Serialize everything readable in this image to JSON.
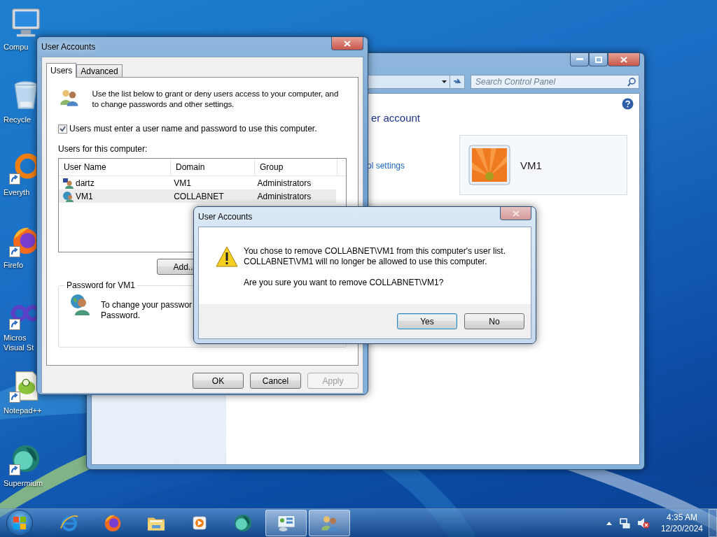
{
  "desktop_icons": [
    {
      "kind": "computer",
      "lines": [
        "Compu"
      ],
      "shortcut": false
    },
    {
      "kind": "recycle-bin",
      "lines": [
        "Recycle"
      ],
      "shortcut": false
    },
    {
      "kind": "ring",
      "lines": [
        "Everyth"
      ],
      "shortcut": true
    },
    {
      "kind": "fox",
      "lines": [
        "Firefo"
      ],
      "shortcut": true
    },
    {
      "kind": "infinity",
      "lines": [
        "Micros",
        "Visual St"
      ],
      "shortcut": true
    },
    {
      "kind": "notepad",
      "lines": [
        "Notepad++"
      ],
      "shortcut": true
    },
    {
      "kind": "globe",
      "lines": [
        "Supermium"
      ],
      "shortcut": true
    }
  ],
  "control_panel": {
    "search": {
      "placeholder": "Search Control Panel"
    },
    "heading": "er account",
    "link": "ol settings",
    "account_card": {
      "name": "VM1"
    }
  },
  "user_accounts": {
    "title": "User Accounts",
    "tabs": [
      {
        "label": "Users",
        "selected": true
      },
      {
        "label": "Advanced",
        "selected": false
      }
    ],
    "intro": "Use the list below to grant or deny users access to your computer, and to change passwords and other settings.",
    "require_password": {
      "label": "Users must enter a user name and password to use this computer.",
      "checked": true
    },
    "list_label": "Users for this computer:",
    "table": {
      "columns": [
        "User Name",
        "Domain",
        "Group"
      ],
      "rows": [
        {
          "kind": "local",
          "selected": false,
          "cells": [
            "dartz",
            "VM1",
            "Administrators"
          ]
        },
        {
          "kind": "domain",
          "selected": true,
          "cells": [
            "VM1",
            "COLLABNET",
            "Administrators"
          ]
        }
      ]
    },
    "add_button": "Add..",
    "password_group": {
      "title": "Password for VM1",
      "lines": [
        "To change your passwor",
        "Password."
      ]
    },
    "buttons": [
      {
        "label": "OK",
        "disabled": false
      },
      {
        "label": "Cancel",
        "disabled": false
      },
      {
        "label": "Apply",
        "disabled": true
      }
    ]
  },
  "message_box": {
    "title": "User Accounts",
    "lines": [
      "You chose to remove COLLABNET\\VM1 from this computer's user list.",
      "COLLABNET\\VM1 will no longer be allowed to use this computer."
    ],
    "question": "Are you sure you want to remove COLLABNET\\VM1?",
    "buttons": [
      {
        "label": "Yes",
        "default": true
      },
      {
        "label": "No",
        "default": false
      }
    ]
  },
  "taskbar": {
    "items": [
      {
        "kind": "browser-e",
        "active": false
      },
      {
        "kind": "fox",
        "active": false
      },
      {
        "kind": "folder",
        "active": false
      },
      {
        "kind": "player",
        "active": false
      },
      {
        "kind": "globe",
        "active": false
      },
      {
        "kind": "control-panel",
        "active": true
      },
      {
        "kind": "users",
        "active": true
      }
    ],
    "clock": {
      "time": "4:35 AM",
      "date": "12/20/2024"
    }
  }
}
